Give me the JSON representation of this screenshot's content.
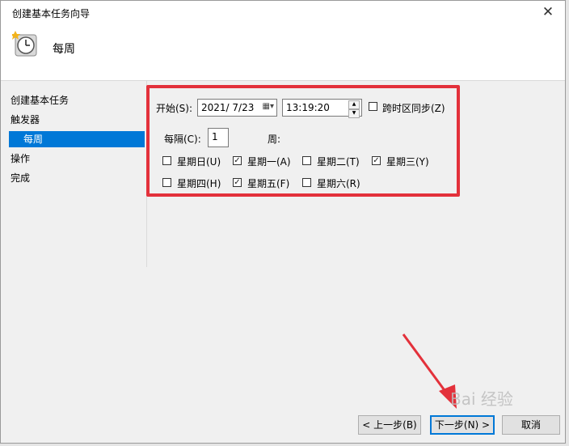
{
  "window": {
    "title": "创建基本任务向导",
    "close_glyph": "✕"
  },
  "header": {
    "heading": "每周",
    "icon": "clock-icon"
  },
  "nav": {
    "items": [
      {
        "label": "创建基本任务",
        "selected": false
      },
      {
        "label": "触发器",
        "selected": false
      },
      {
        "label": "每周",
        "selected": true
      },
      {
        "label": "操作",
        "selected": false
      },
      {
        "label": "完成",
        "selected": false
      }
    ]
  },
  "form": {
    "start_label": "开始(S):",
    "start_date": "2021/  7/23",
    "start_time": "13:19:20",
    "sync_timezone": {
      "label": "跨时区同步(Z)",
      "checked": false
    },
    "recur_label": "每隔(C):",
    "recur_value": "1",
    "recur_unit": "周:",
    "days": [
      {
        "label": "星期日(U)",
        "checked": false
      },
      {
        "label": "星期一(A)",
        "checked": true
      },
      {
        "label": "星期二(T)",
        "checked": false
      },
      {
        "label": "星期三(Y)",
        "checked": true
      },
      {
        "label": "星期四(H)",
        "checked": false
      },
      {
        "label": "星期五(F)",
        "checked": true
      },
      {
        "label": "星期六(R)",
        "checked": false
      }
    ]
  },
  "buttons": {
    "back": "< 上一步(B)",
    "next": "下一步(N) >",
    "cancel": "取消"
  },
  "annotation": {
    "highlight_color": "#e3313b",
    "arrow_color": "#e3313b"
  },
  "watermark": "Bai 经验"
}
